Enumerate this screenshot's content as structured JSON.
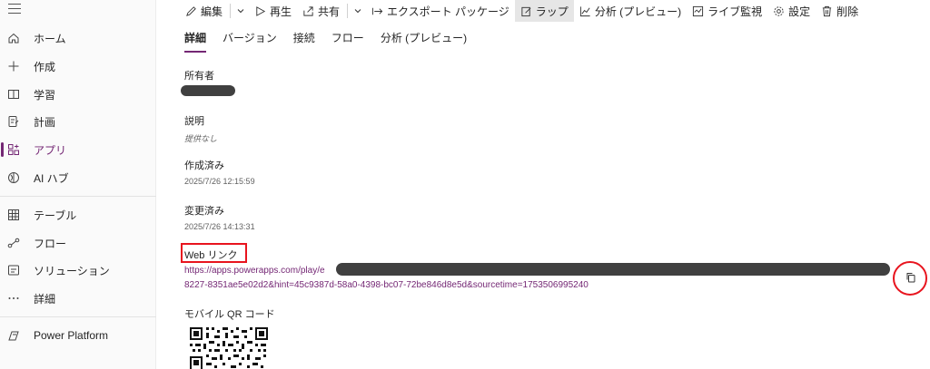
{
  "sidebar": {
    "items": [
      {
        "label": "ホーム",
        "icon": "home-icon"
      },
      {
        "label": "作成",
        "icon": "plus-icon"
      },
      {
        "label": "学習",
        "icon": "book-icon"
      },
      {
        "label": "計画",
        "icon": "plan-icon"
      },
      {
        "label": "アプリ",
        "icon": "apps-icon"
      },
      {
        "label": "AI ハブ",
        "icon": "ai-hub-icon"
      },
      {
        "label": "テーブル",
        "icon": "table-icon"
      },
      {
        "label": "フロー",
        "icon": "flow-icon"
      },
      {
        "label": "ソリューション",
        "icon": "solution-icon"
      },
      {
        "label": "詳細",
        "icon": "more-icon"
      },
      {
        "label": "Power Platform",
        "icon": "power-platform-icon"
      }
    ],
    "active_item": "アプリ"
  },
  "toolbar": {
    "edit": "編集",
    "play": "再生",
    "share": "共有",
    "export": "エクスポート パッケージ",
    "wrap": "ラップ",
    "analytics": "分析 (プレビュー)",
    "live_monitor": "ライブ監視",
    "settings": "設定",
    "delete": "削除"
  },
  "tabs": [
    {
      "label": "詳細",
      "selected": true
    },
    {
      "label": "バージョン",
      "selected": false
    },
    {
      "label": "接続",
      "selected": false
    },
    {
      "label": "フロー",
      "selected": false
    },
    {
      "label": "分析 (プレビュー)",
      "selected": false
    }
  ],
  "details": {
    "owner_label": "所有者",
    "description_label": "説明",
    "description_value": "提供なし",
    "created_label": "作成済み",
    "created_value": "2025/7/26 12:15:59",
    "modified_label": "変更済み",
    "modified_value": "2025/7/26 14:13:31",
    "weblink_label": "Web リンク",
    "weblink_line1": "https://apps.powerapps.com/play/e",
    "weblink_line2": "8227-8351ae5e02d2&hint=45c9387d-58a0-4398-bc07-72be846d8e5d&sourcetime=1753506995240",
    "qr_label": "モバイル QR コード"
  },
  "colors": {
    "accent": "#742774",
    "annotation_red": "#e8141e"
  }
}
